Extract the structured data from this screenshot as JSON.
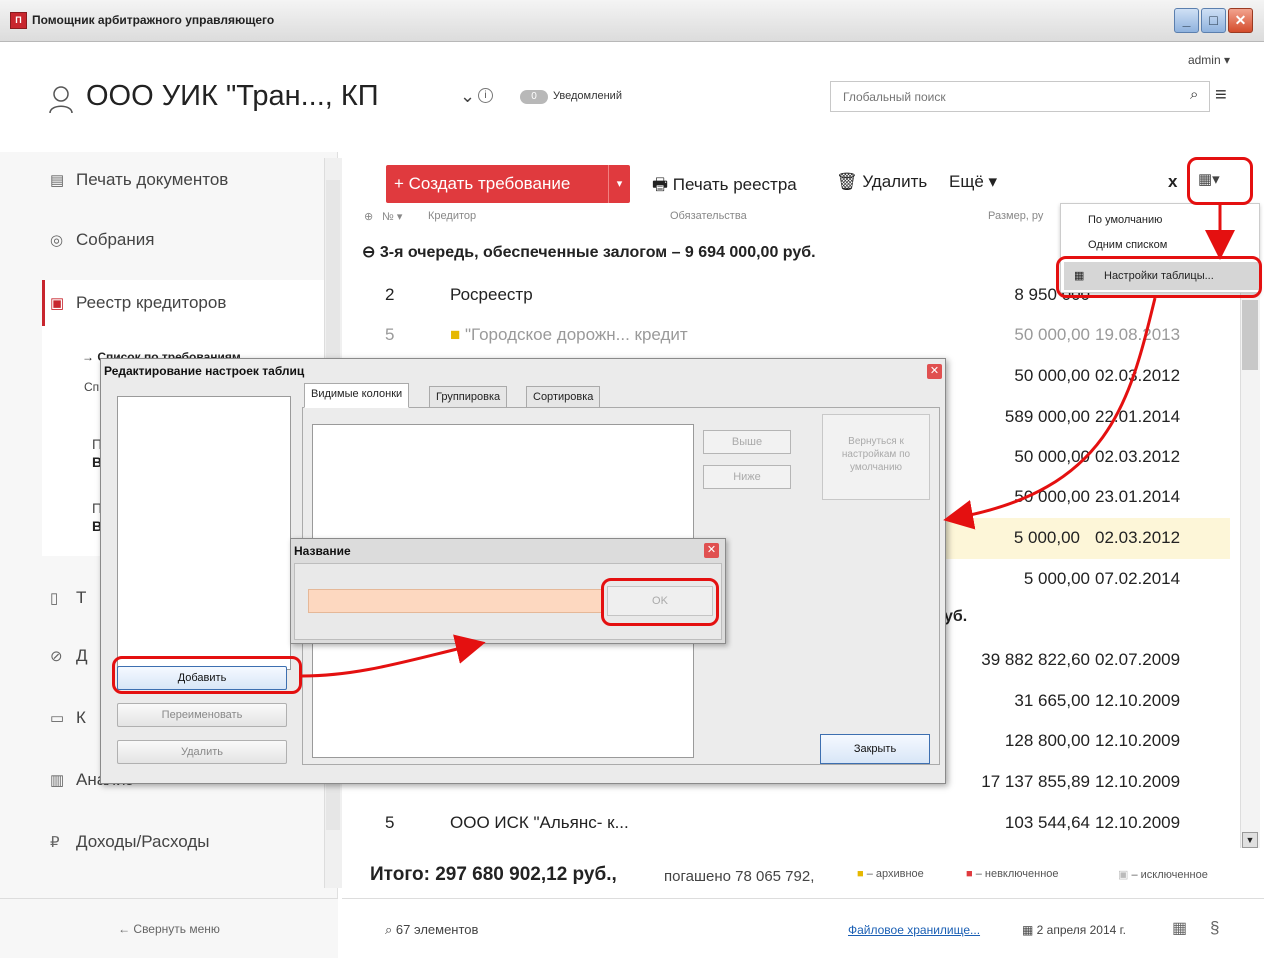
{
  "window": {
    "icon_text": "П",
    "title": "Помощник арбитражного управляющего",
    "min": "_",
    "max": "□",
    "close": "✕"
  },
  "header": {
    "user": "admin ▾",
    "org_title": "ООО УИК \"Тран..., КП",
    "chevron": "⌄",
    "info": "i",
    "notif_count": "0",
    "notif_label": "Уведомлений",
    "search_placeholder": "Глобальный поиск",
    "search_icon": "⌕",
    "menu_icon": "≡"
  },
  "sidebar": {
    "items": [
      {
        "icon": "▤",
        "label": "Печать документов"
      },
      {
        "icon": "◎",
        "label": "Собрания"
      },
      {
        "icon": "▣",
        "label": "Реестр кредиторов"
      },
      {
        "icon": "▯",
        "label": "Т"
      },
      {
        "icon": "⊘",
        "label": "Д"
      },
      {
        "icon": "▭",
        "label": "К"
      },
      {
        "icon": "▥",
        "label": "Анализ"
      },
      {
        "icon": "₽",
        "label": "Доходы/Расходы"
      }
    ],
    "sub_items": [
      "→ Список по требованиям",
      "Сп",
      "П",
      "В",
      "П",
      "В"
    ],
    "collapse": "← Свернуть меню"
  },
  "toolbar": {
    "create": "+ Создать требование",
    "create_split": "▾",
    "print": "Печать реестра",
    "delete": "Удалить",
    "more": "Ещё ▾",
    "x": "x",
    "settings_icon": "▦▾"
  },
  "grid": {
    "headers": {
      "no": "№ ▾",
      "creditor": "Кредитор",
      "obligations": "Обязательства",
      "size": "Размер, ру"
    },
    "group1": "3-я очередь, обеспеченные залогом – 9 694 000,00 руб.",
    "group2_tail": "уб.",
    "rows": [
      {
        "no": "2",
        "name": "Росреестр",
        "amount": "8 950 000",
        "date": ""
      },
      {
        "no": "5",
        "name": "\"Городское дорожн...  кредит",
        "amount": "50 000,00",
        "date": "19.08.2013"
      },
      {
        "no": "",
        "name": "",
        "amount": "50 000,00",
        "date": "02.03.2012"
      },
      {
        "no": "",
        "name": "",
        "amount": "589 000,00",
        "date": "22.01.2014"
      },
      {
        "no": "",
        "name": "",
        "amount": "50 000,00",
        "date": "02.03.2012"
      },
      {
        "no": "",
        "name": "",
        "amount": "50 000,00",
        "date": "23.01.2014"
      },
      {
        "no": "",
        "name": "",
        "amount": "5 000,00",
        "date": "02.03.2012"
      },
      {
        "no": "",
        "name": "",
        "amount": "5 000,00",
        "date": "07.02.2014"
      },
      {
        "no": "",
        "name": "",
        "amount": "39 882 822,60",
        "date": "02.07.2009"
      },
      {
        "no": "",
        "name": "",
        "amount": "31 665,00",
        "date": "12.10.2009"
      },
      {
        "no": "",
        "name": "",
        "amount": "128 800,00",
        "date": "12.10.2009"
      },
      {
        "no": "",
        "name": "",
        "amount": "17 137 855,89",
        "date": "12.10.2009"
      },
      {
        "no": "5",
        "name": "ООО ИСК \"Альянс- к...",
        "amount": "103 544,64",
        "date": "12.10.2009"
      }
    ]
  },
  "summary": {
    "total": "Итого: 297 680 902,12 руб.,",
    "paid": "погашено 78 065 792,",
    "legend_archive": "– архивное",
    "legend_excluded_not": "– невключенное",
    "legend_excluded": "– исключенное"
  },
  "footer": {
    "count": "67 элементов",
    "storage": "Файловое хранилище...",
    "date": "2 апреля 2014 г.",
    "calc_icon": "▦",
    "para_icon": "§"
  },
  "view_menu": {
    "default": "По умолчанию",
    "one_list": "Одним списком",
    "table_settings": "Настройки таблицы..."
  },
  "dialog": {
    "title": "Редактирование настроек таблиц",
    "close": "✕",
    "tabs": [
      "Видимые колонки",
      "Группировка",
      "Сортировка"
    ],
    "add": "Добавить",
    "rename": "Переименовать",
    "remove": "Удалить",
    "up": "Выше",
    "down": "Ниже",
    "reset": "Вернуться к настройкам по умолчанию",
    "close_btn": "Закрыть"
  },
  "name_dialog": {
    "title": "Название",
    "close": "✕",
    "value": "",
    "ok": "OK"
  },
  "colors": {
    "accent": "#e03a3e",
    "annotation": "#e41010",
    "highlight": "#fdf6d8",
    "input_bg": "#fdd8c0"
  }
}
